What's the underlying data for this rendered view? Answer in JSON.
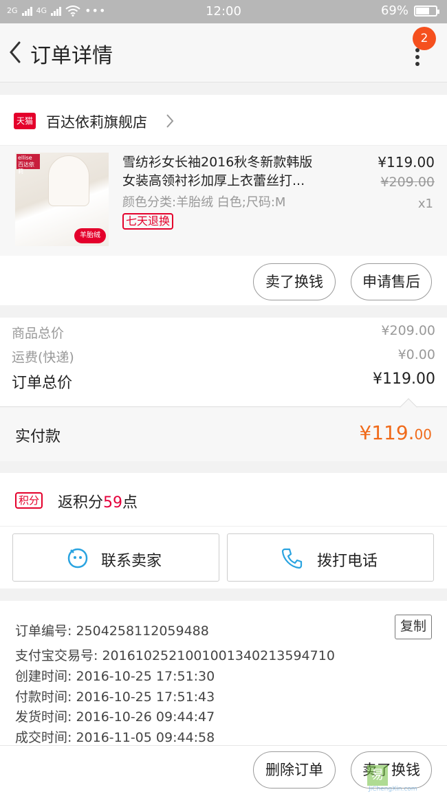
{
  "status_bar": {
    "network_left": "2G",
    "network_right": "4G",
    "time": "12:00",
    "battery_percent": "69%",
    "battery_level": 0.69
  },
  "nav": {
    "title": "订单详情",
    "badge_count": "2"
  },
  "store": {
    "name": "百达依莉旗舰店",
    "platform_label": "天猫"
  },
  "product": {
    "title_line1": "雪纺衫女长袖2016秋冬新款韩版",
    "title_line2": "女装高领衬衫加厚上衣蕾丝打...",
    "sku": "颜色分类:羊胎绒 白色;尺码:M",
    "return_badge": "七天退换",
    "price_now": "¥119.00",
    "price_original": "¥209.00",
    "quantity": "x1",
    "thumb_brand": "ellise 百达依莉",
    "thumb_tag": "羊胎绒"
  },
  "actions": {
    "sell_label": "卖了换钱",
    "after_sale_label": "申请售后"
  },
  "totals": {
    "goods_label": "商品总价",
    "goods_value": "¥209.00",
    "shipping_label": "运费(快递)",
    "shipping_value": "¥0.00",
    "order_total_label": "订单总价",
    "order_total_value": "¥119.00"
  },
  "payment": {
    "label": "实付款",
    "amount_main": "¥119.",
    "amount_cents": "00"
  },
  "points": {
    "tag": "积分",
    "prefix": "返积分",
    "value": "59",
    "suffix": "点"
  },
  "contact": {
    "seller_label": "联系卖家",
    "call_label": "拨打电话"
  },
  "order_info": {
    "copy_label": "复制",
    "lines": [
      "订单编号: 2504258112059488",
      "支付宝交易号: 2016102521001001340213594710",
      "创建时间: 2016-10-25 17:51:30",
      "付款时间: 2016-10-25 17:51:43",
      "发货时间: 2016-10-26 09:44:47",
      "成交时间: 2016-11-05 09:44:58"
    ]
  },
  "bottom_bar": {
    "delete_label": "删除订单",
    "sell_label": "卖了换钱"
  },
  "watermark": {
    "mark": "易",
    "url": "JiChengXin.com"
  },
  "colors": {
    "accent_orange": "#f06a1a",
    "tmall_red": "#e4002b",
    "badge_orange": "#f5501e",
    "icon_blue": "#29a3e0"
  }
}
